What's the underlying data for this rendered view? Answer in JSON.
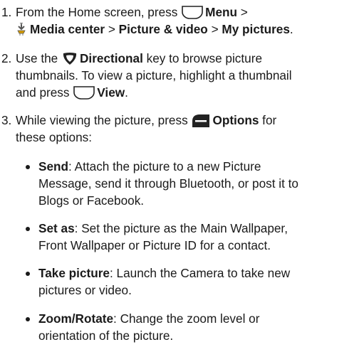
{
  "steps": [
    {
      "number": "1.",
      "line1_pre": "From the Home screen, press",
      "line1_key": "Menu",
      "line1_post": " >",
      "line2_item1": "Media center",
      "sep": " > ",
      "line2_item2": "Picture & video",
      "line2_item3": "My pictures",
      "line2_end": "."
    },
    {
      "number": "2.",
      "line1_pre": "Use the",
      "line1_key": "Directional",
      "line1_post": " key to browse picture",
      "line2": "thumbnails. To view a picture, highlight a thumbnail",
      "line3_pre": "and press",
      "line3_key": "View",
      "line3_end": "."
    },
    {
      "number": "3.",
      "line1_pre": "While viewing the picture, press",
      "line1_key": "Options",
      "line1_post": " for",
      "line2": "these options:"
    }
  ],
  "options": [
    {
      "term": "Send",
      "lines": [
        ": Attach the picture to a new Picture",
        "Message, send it through Bluetooth, or post it to",
        "Blogs or Facebook."
      ]
    },
    {
      "term": "Set as",
      "lines": [
        ": Set the picture as the Main Wallpaper,",
        "Front Wallpaper or Picture ID for a contact."
      ]
    },
    {
      "term": "Take picture",
      "lines": [
        ": Launch the Camera to take new",
        "pictures or video."
      ]
    },
    {
      "term": "Zoom/Rotate",
      "lines": [
        ": Change the zoom level or",
        "orientation of the picture."
      ]
    }
  ],
  "icons": {
    "soft_key": "left-soft-key-icon",
    "directional_key": "directional-key-icon",
    "options_key": "right-soft-key-icon",
    "media_center": "media-center-icon"
  }
}
